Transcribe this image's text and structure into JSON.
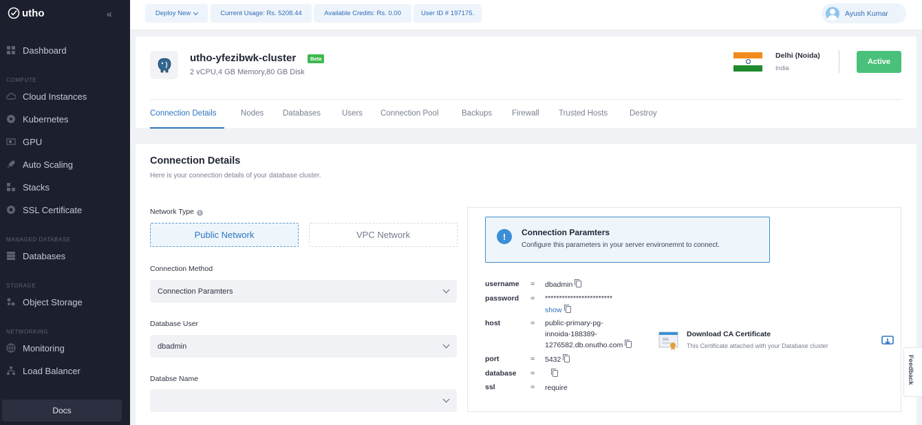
{
  "brand": {
    "name": "utho"
  },
  "sidebar": {
    "dashboard": "Dashboard",
    "section_compute": "COMPUTE",
    "cloud_instances": "Cloud Instances",
    "kubernetes": "Kubernetes",
    "gpu": "GPU",
    "auto_scaling": "Auto Scaling",
    "stacks": "Stacks",
    "ssl_certificate": "SSL Certificate",
    "section_managed_db": "MANAGED DATABASE",
    "databases": "Databases",
    "section_storage": "STORAGE",
    "object_storage": "Object Storage",
    "section_networking": "NETWORKING",
    "monitoring": "Monitoring",
    "load_balancer": "Load Balancer",
    "docs": "Docs"
  },
  "topbar": {
    "deploy_new": "Deploy New",
    "current_usage": "Current Usage: Rs. 5208.44",
    "available_credits": "Available Credits: Rs. 0.00",
    "user_id": "User ID # 197175.",
    "user_name": "Ayush Kumar"
  },
  "cluster": {
    "name": "utho-yfezibwk-cluster",
    "badge": "Beta",
    "specs": "2 vCPU,4 GB Memory,80 GB Disk",
    "region": "Delhi (Noida)",
    "country": "India",
    "status": "Active",
    "status_color": "#4ac17a"
  },
  "tabs": {
    "connection_details": "Connection Details",
    "nodes": "Nodes",
    "databases": "Databases",
    "users": "Users",
    "connection_pool": "Connection Pool",
    "backups": "Backups",
    "firewall": "Firewall",
    "trusted_hosts": "Trusted Hosts",
    "destroy": "Destroy"
  },
  "main": {
    "title": "Connection Details",
    "subtitle": "Here is your connection details of your database cluster.",
    "network_type_label": "Network Type",
    "public_network": "Public Network",
    "vpc_network": "VPC Network",
    "connection_method_label": "Connection Method",
    "connection_method_value": "Connection Paramters",
    "database_user_label": "Database User",
    "database_user_value": "dbadmin",
    "database_name_label": "Databse Name",
    "database_name_value": ""
  },
  "panel": {
    "alert_title": "Connection Paramters",
    "alert_text": "Configure this parameters in your server environemnt to connect.",
    "eq": "=",
    "username_key": "username",
    "username_value": "dbadmin",
    "password_key": "password",
    "password_value": "************************",
    "show_label": "show",
    "host_key": "host",
    "host_line1": "public-primary-pg-",
    "host_line2": "innoida-188389-",
    "host_line3": "1276582.db.onutho.com",
    "port_key": "port",
    "port_value": "5432",
    "database_key": "database",
    "database_value": "",
    "ssl_key": "ssl",
    "ssl_value": "require",
    "cert_title": "Download CA Certificate",
    "cert_subtitle": "This Certificate attached with your Database cluster",
    "cert_icon_label": "SSL"
  },
  "feedback": "Feedback",
  "colors": {
    "accent": "#2f74c0",
    "sidebar_bg": "#1c1f2e",
    "active_green": "#4ac17a"
  }
}
